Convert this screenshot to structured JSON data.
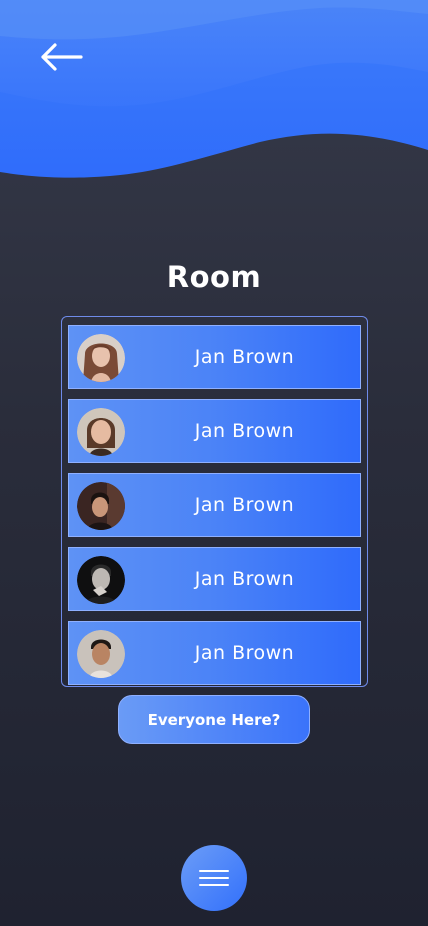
{
  "header": {
    "back_icon": "arrow-left-icon",
    "accent_color": "#3a7bfa"
  },
  "room": {
    "title": "Room",
    "members": [
      {
        "name": "Jan Brown",
        "avatar": "avatar-woman-long-hair"
      },
      {
        "name": "Jan Brown",
        "avatar": "avatar-woman-portrait"
      },
      {
        "name": "Jan Brown",
        "avatar": "avatar-man-dark"
      },
      {
        "name": "Jan Brown",
        "avatar": "avatar-man-hand-on-chin"
      },
      {
        "name": "Jan Brown",
        "avatar": "avatar-young-man"
      }
    ]
  },
  "actions": {
    "everyone_here_label": "Everyone Here?",
    "menu_icon": "hamburger-menu-icon"
  },
  "colors": {
    "background_top": "#363a4a",
    "background_bottom": "#1f2230",
    "button_gradient_start": "#6a9bf6",
    "button_gradient_end": "#3a73fa"
  }
}
